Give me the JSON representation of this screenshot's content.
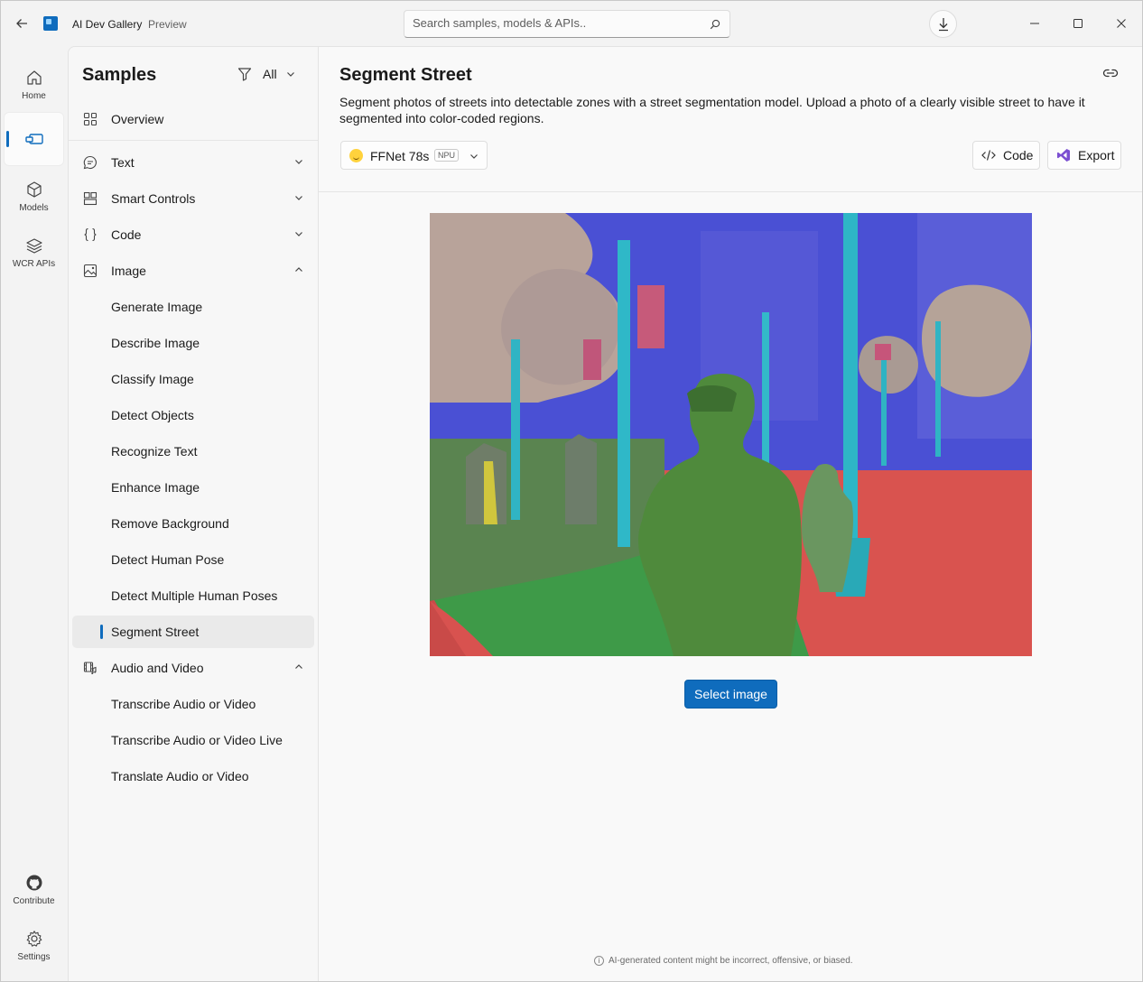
{
  "window": {
    "app_title": "AI Dev Gallery",
    "app_subtitle": "Preview",
    "search_placeholder": "Search samples, models & APIs.."
  },
  "rail": {
    "items": [
      {
        "label": "Home",
        "icon": "home-icon"
      },
      {
        "label": "",
        "icon": "samples-icon",
        "active": true
      },
      {
        "label": "Models",
        "icon": "cube-icon"
      },
      {
        "label": "WCR APIs",
        "icon": "layers-icon"
      }
    ],
    "bottom": [
      {
        "label": "Contribute",
        "icon": "github-icon"
      },
      {
        "label": "Settings",
        "icon": "gear-icon"
      }
    ]
  },
  "sidebar": {
    "title": "Samples",
    "filter_label": "All",
    "items": [
      {
        "label": "Overview"
      },
      {
        "label": "Text"
      },
      {
        "label": "Smart Controls"
      },
      {
        "label": "Code"
      },
      {
        "label": "Image"
      },
      {
        "label": "Generate Image"
      },
      {
        "label": "Describe Image"
      },
      {
        "label": "Classify Image"
      },
      {
        "label": "Detect Objects"
      },
      {
        "label": "Recognize Text"
      },
      {
        "label": "Enhance Image"
      },
      {
        "label": "Remove Background"
      },
      {
        "label": "Detect Human Pose"
      },
      {
        "label": "Detect Multiple Human Poses"
      },
      {
        "label": "Segment Street",
        "selected": true
      },
      {
        "label": "Audio and Video"
      },
      {
        "label": "Transcribe Audio or Video"
      },
      {
        "label": "Transcribe Audio or Video Live"
      },
      {
        "label": "Translate Audio or Video"
      }
    ]
  },
  "main": {
    "title": "Segment Street",
    "description": "Segment photos of streets into detectable zones with a street segmentation model. Upload a photo of a clearly visible street to have it segmented into color-coded regions.",
    "model": {
      "name": "FFNet 78s",
      "badge": "NPU"
    },
    "code_label": "Code",
    "export_label": "Export",
    "select_image_label": "Select image",
    "disclaimer": "AI-generated content might be incorrect, offensive, or biased.",
    "segment_colors": {
      "building_sky": "#4b50d6",
      "road": "#d9514e",
      "sidewalk": "#3f9a47",
      "person": "#4f8a3c",
      "pole": "#2fb7c9",
      "vegetation": "#b9a69a"
    }
  }
}
